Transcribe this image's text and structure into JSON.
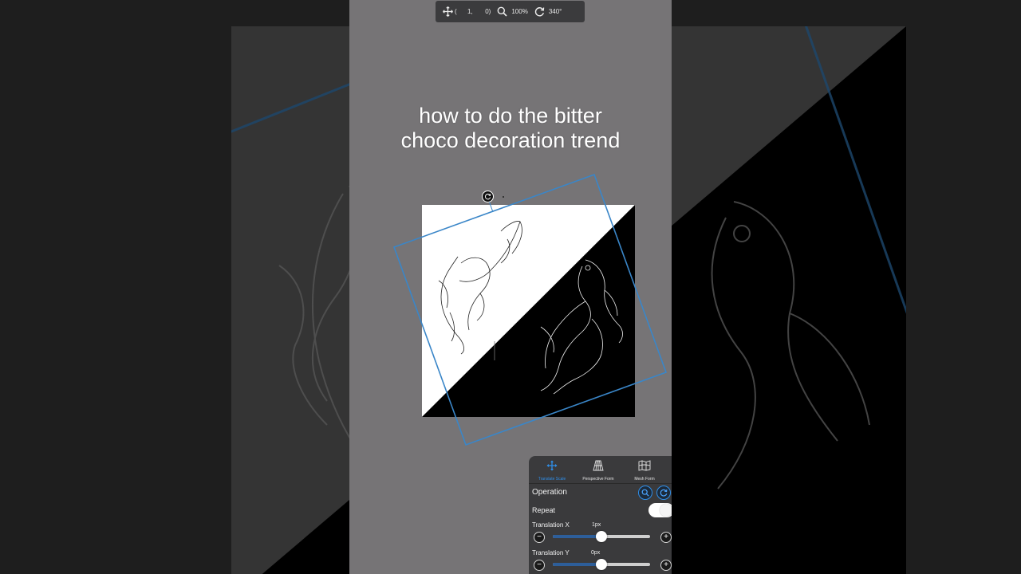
{
  "caption": {
    "line1": "how to do the bitter",
    "line2": "choco decoration trend"
  },
  "toolbar": {
    "move_icon": "move-arrows-icon",
    "coords": "(      1,       0)",
    "zoom_icon": "magnifier-icon",
    "zoom": "100%",
    "rotate_icon": "rotate-icon",
    "angle": "340°"
  },
  "transform_panel": {
    "tabs": [
      {
        "label": "Translate Scale",
        "icon": "translate-arrows-icon",
        "active": true
      },
      {
        "label": "Perspective Form",
        "icon": "perspective-grid-icon",
        "active": false
      },
      {
        "label": "Mesh Form",
        "icon": "mesh-map-icon",
        "active": false
      }
    ],
    "operation_label": "Operation",
    "repeat_label": "Repeat",
    "repeat_on": true,
    "translation_x": {
      "label": "Translation X",
      "value": "1px",
      "position": 0.46
    },
    "translation_y": {
      "label": "Translation Y",
      "value": "0px",
      "position": 0.46
    },
    "minus": "−",
    "plus": "+"
  },
  "colors": {
    "accent": "#2f8ee8",
    "selection": "#3a86c8",
    "panel": "#3a3a3c",
    "phone_bg": "#767476"
  }
}
